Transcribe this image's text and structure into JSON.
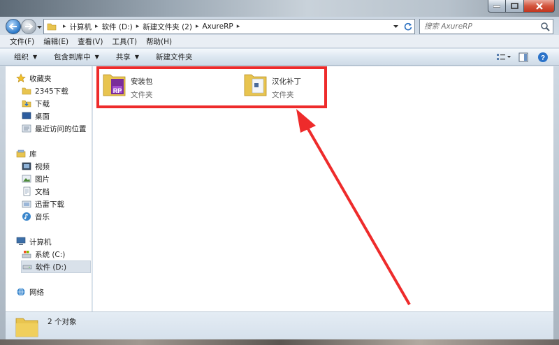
{
  "address": {
    "crumbs": [
      "计算机",
      "软件 (D:)",
      "新建文件夹 (2)",
      "AxureRP"
    ]
  },
  "search": {
    "placeholder": "搜索 AxureRP"
  },
  "menu": [
    "文件(F)",
    "编辑(E)",
    "查看(V)",
    "工具(T)",
    "帮助(H)"
  ],
  "toolbar": {
    "organize": "组织",
    "include_library": "包含到库中",
    "share": "共享",
    "new_folder": "新建文件夹"
  },
  "nav": {
    "favorites": "收藏夹",
    "fav_items": [
      "2345下载",
      "下载",
      "桌面",
      "最近访问的位置"
    ],
    "libraries": "库",
    "lib_items": [
      "视频",
      "图片",
      "文档",
      "迅雷下载",
      "音乐"
    ],
    "computer": "计算机",
    "drives": [
      "系统 (C:)",
      "软件 (D:)"
    ],
    "network": "网络"
  },
  "files": [
    {
      "name": "安装包",
      "type": "文件夹"
    },
    {
      "name": "汉化补丁",
      "type": "文件夹"
    }
  ],
  "status": {
    "count": "2 个对象"
  },
  "colors": {
    "annotation": "#ee2b2b",
    "folder": "#e8c44f"
  }
}
